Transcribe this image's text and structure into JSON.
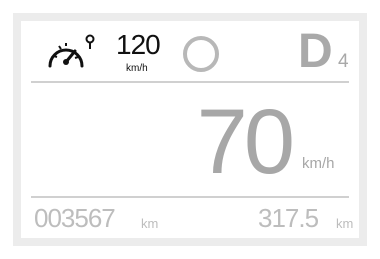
{
  "cluster": {
    "speed_limiter": {
      "icon": "speedometer-limiter-icon",
      "value": "120",
      "unit": "km/h"
    },
    "status_indicator": "ring-indicator-icon",
    "gear": {
      "mode": "D",
      "number": "4"
    },
    "speed": {
      "value": "70",
      "unit": "km/h"
    },
    "odometer": {
      "value": "003567",
      "unit": "km"
    },
    "trip": {
      "value": "317.5",
      "unit": "km"
    }
  },
  "colors": {
    "outer_panel": "#ececec",
    "display_background": "#ffffff",
    "primary_text": "#111111",
    "speed_text": "#a7a7a7",
    "secondary_text": "#bdbdbd",
    "divider": "#d0d0d0"
  }
}
